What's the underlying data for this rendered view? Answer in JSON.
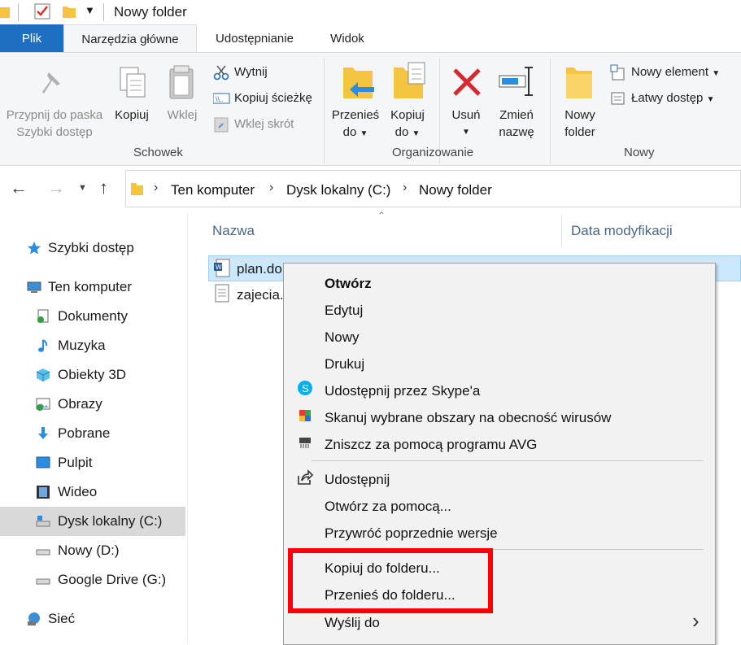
{
  "window": {
    "title": "Nowy folder"
  },
  "ribbon_tabs": [
    "Plik",
    "Narzędzia główne",
    "Udostępnianie",
    "Widok"
  ],
  "ribbon": {
    "pin_label_1": "Przypnij do paska",
    "pin_label_2": "Szybki dostęp",
    "copy": "Kopiuj",
    "paste": "Wklej",
    "cut": "Wytnij",
    "copy_path": "Kopiuj ścieżkę",
    "paste_shortcut": "Wklej skrót",
    "group_clipboard": "Schowek",
    "move_to_1": "Przenieś",
    "move_to_2": "do",
    "copy_to_1": "Kopiuj",
    "copy_to_2": "do",
    "delete": "Usuń",
    "rename_1": "Zmień",
    "rename_2": "nazwę",
    "group_organize": "Organizowanie",
    "new_folder_1": "Nowy",
    "new_folder_2": "folder",
    "new_item": "Nowy element",
    "easy_access": "Łatwy dostęp",
    "group_new": "Nowy"
  },
  "address": {
    "crumbs": [
      "Ten komputer",
      "Dysk lokalny (C:)",
      "Nowy folder"
    ]
  },
  "nav_pane": [
    "Szybki dostęp",
    "Ten komputer",
    "Dokumenty",
    "Muzyka",
    "Obiekty 3D",
    "Obrazy",
    "Pobrane",
    "Pulpit",
    "Wideo",
    "Dysk lokalny (C:)",
    "Nowy (D:)",
    "Google Drive (G:)",
    "Sieć"
  ],
  "columns": {
    "name": "Nazwa",
    "modified": "Data modyfikacji"
  },
  "files": [
    "plan.do",
    "zajecia.t"
  ],
  "context_menu": [
    "Otwórz",
    "Edytuj",
    "Nowy",
    "Drukuj",
    "Udostępnij przez Skype'a",
    "Skanuj wybrane obszary na obecność wirusów",
    "Zniszcz za pomocą programu AVG",
    "Udostępnij",
    "Otwórz za pomocą...",
    "Przywróć poprzednie wersje",
    "Kopiuj do folderu...",
    "Przenieś do folderu...",
    "Wyślij do"
  ],
  "colors": {
    "accent": "#1e6fc1",
    "highlight_box": "#ff0000",
    "selection": "#cce8ff"
  }
}
